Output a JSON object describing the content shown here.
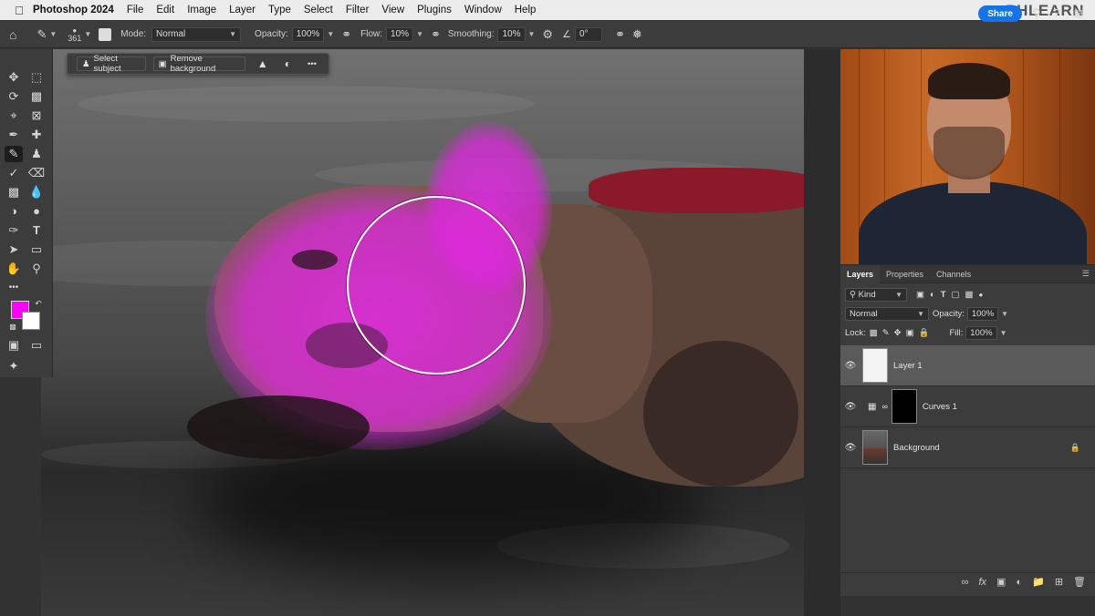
{
  "menubar": {
    "apple": "",
    "app_name": "Photoshop 2024",
    "items": [
      "File",
      "Edit",
      "Image",
      "Layer",
      "Type",
      "Select",
      "Filter",
      "View",
      "Plugins",
      "Window",
      "Help"
    ],
    "brand": "PHLEARN"
  },
  "options": {
    "brush_size": "361",
    "mode_label": "Mode:",
    "mode_value": "Normal",
    "opacity_label": "Opacity:",
    "opacity_value": "100%",
    "flow_label": "Flow:",
    "flow_value": "10%",
    "smoothing_label": "Smoothing:",
    "smoothing_value": "10%",
    "angle_value": "0°",
    "share_label": "Share"
  },
  "context_bar": {
    "select_subject": "Select subject",
    "remove_background": "Remove background",
    "more": "•••"
  },
  "colors": {
    "foreground": "#ff00ff",
    "background": "#ffffff",
    "accent": "#1473e6"
  },
  "tools": {
    "more": "•••"
  },
  "layers_panel": {
    "tabs": [
      "Layers",
      "Properties",
      "Channels"
    ],
    "kind_label": "Kind",
    "blend_mode": "Normal",
    "opacity_label": "Opacity:",
    "opacity_value": "100%",
    "lock_label": "Lock:",
    "fill_label": "Fill:",
    "fill_value": "100%",
    "layers": [
      {
        "name": "Layer 1"
      },
      {
        "name": "Curves 1"
      },
      {
        "name": "Background"
      }
    ]
  }
}
